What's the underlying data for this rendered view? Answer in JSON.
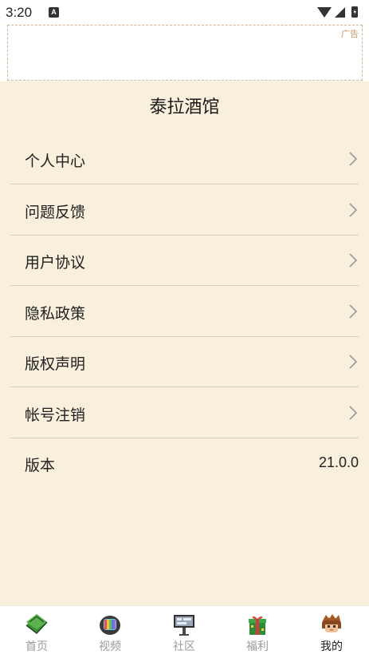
{
  "status_bar": {
    "time": "3:20",
    "notification_glyph": "A"
  },
  "ad": {
    "label": "广告"
  },
  "page": {
    "title": "泰拉酒馆"
  },
  "menu": [
    {
      "label": "个人中心",
      "icon": "chevron-right-icon"
    },
    {
      "label": "问题反馈",
      "icon": "chevron-right-icon"
    },
    {
      "label": "用户协议",
      "icon": "chevron-right-icon"
    },
    {
      "label": "隐私政策",
      "icon": "chevron-right-icon"
    },
    {
      "label": "版权声明",
      "icon": "chevron-right-icon"
    },
    {
      "label": "帐号注销",
      "icon": "chevron-right-icon"
    }
  ],
  "version": {
    "label": "版本",
    "value": "21.0.0"
  },
  "tabs": [
    {
      "label": "首页",
      "icon": "book-icon",
      "active": false
    },
    {
      "label": "视频",
      "icon": "tv-icon",
      "active": false
    },
    {
      "label": "社区",
      "icon": "signboard-icon",
      "active": false
    },
    {
      "label": "福利",
      "icon": "gift-icon",
      "active": false
    },
    {
      "label": "我的",
      "icon": "avatar-icon",
      "active": true
    }
  ],
  "colors": {
    "background": "#f8efdc",
    "divider": "#dfcdb0",
    "ad_border": "#d6b58c",
    "tab_active": "#222222",
    "tab_inactive": "#9a9a9a"
  }
}
